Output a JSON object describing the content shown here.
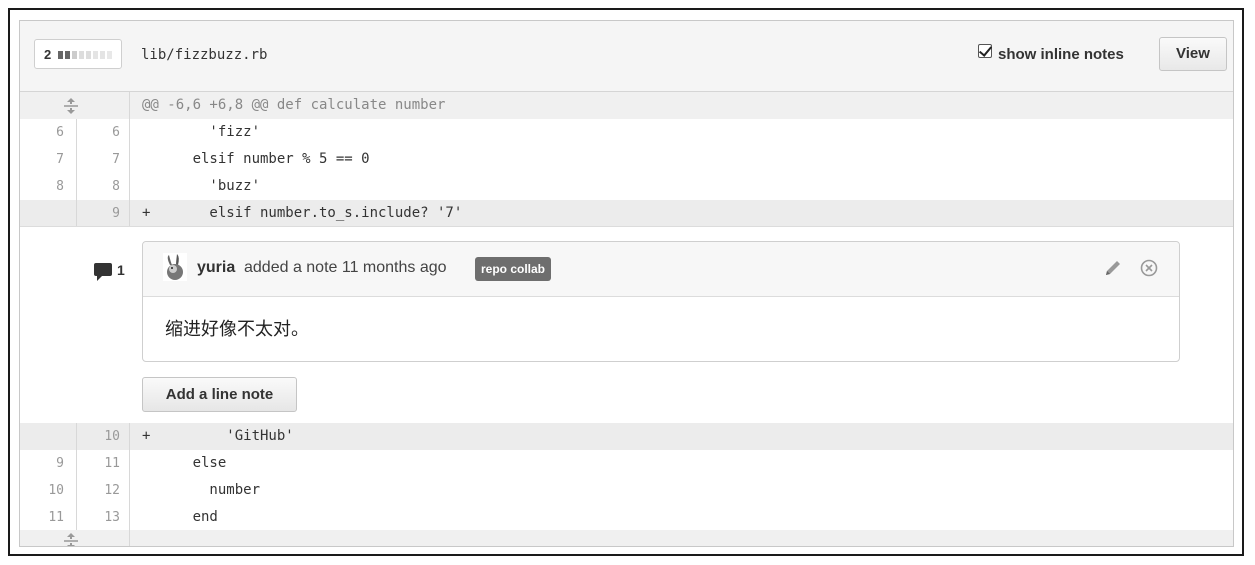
{
  "file": {
    "changed_count": "2",
    "name": "lib/fizzbuzz.rb",
    "show_notes_label": "show inline notes",
    "show_notes_checked": true,
    "view_label": "View",
    "stat_colors": [
      "#666666",
      "#666666",
      "#cccccc",
      "#cccccc",
      "#cccccc"
    ]
  },
  "diff": {
    "hunk_header": "@@ -6,6 +6,8 @@ def calculate number",
    "lines_before": [
      {
        "old": "6",
        "new": "6",
        "code": "        'fizz'",
        "type": "context"
      },
      {
        "old": "7",
        "new": "7",
        "code": "      elsif number % 5 == 0",
        "type": "context"
      },
      {
        "old": "8",
        "new": "8",
        "code": "        'buzz'",
        "type": "context"
      },
      {
        "old": "",
        "new": "9",
        "code": "+       elsif number.to_s.include? '7'",
        "type": "added"
      }
    ],
    "lines_after": [
      {
        "old": "",
        "new": "10",
        "code": "+         'GitHub'",
        "type": "added"
      },
      {
        "old": "9",
        "new": "11",
        "code": "      else",
        "type": "context"
      },
      {
        "old": "10",
        "new": "12",
        "code": "        number",
        "type": "context"
      },
      {
        "old": "11",
        "new": "13",
        "code": "      end",
        "type": "context"
      }
    ]
  },
  "note": {
    "count": "1",
    "author": "yuria",
    "action": "added a note 11 months ago",
    "badge": "repo collab",
    "body": "缩进好像不太对。",
    "add_line_note_label": "Add a line note"
  },
  "icons": {
    "expand": "expand-icon",
    "comment": "comment-icon",
    "edit": "pencil-icon",
    "delete": "close-circle-icon"
  }
}
